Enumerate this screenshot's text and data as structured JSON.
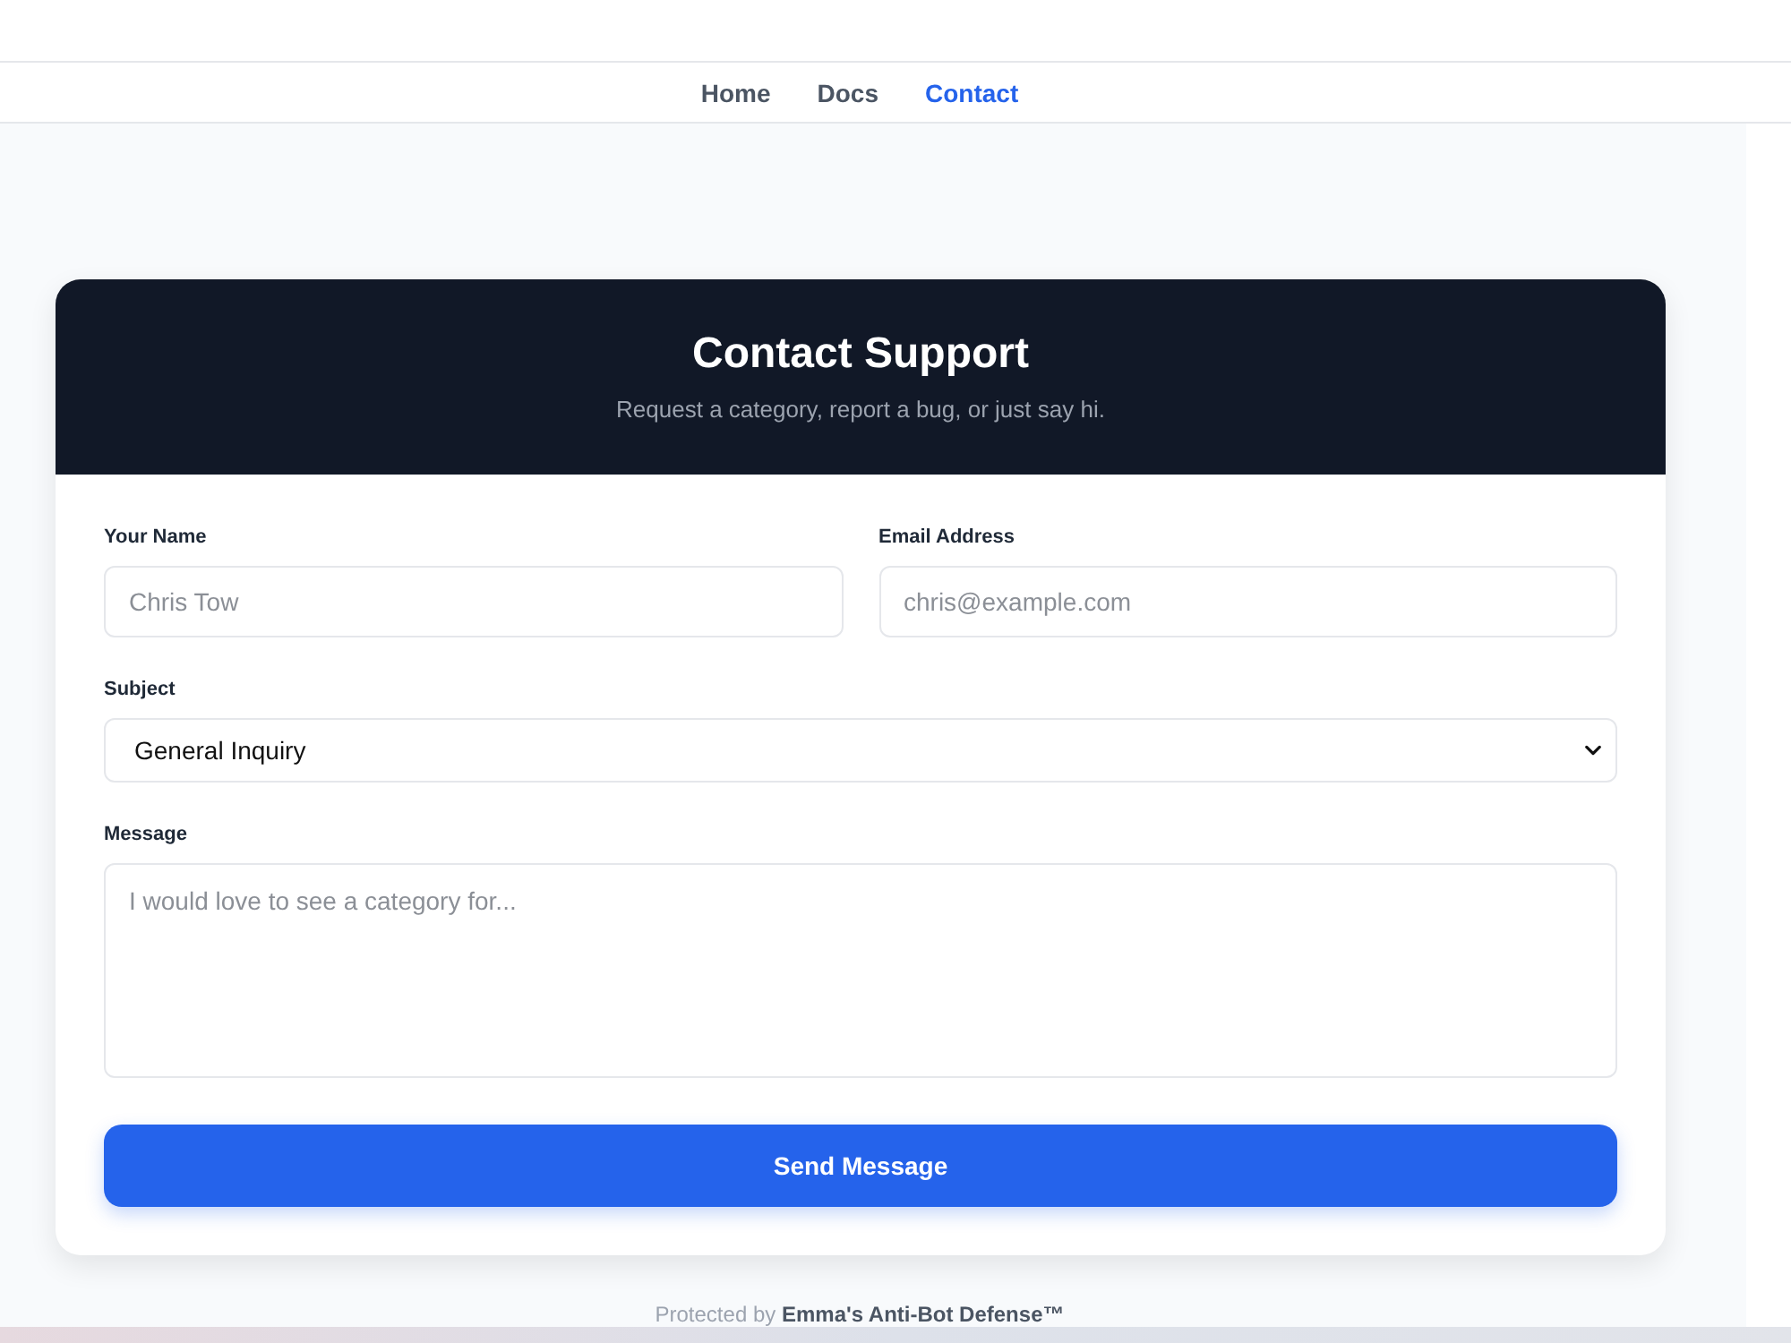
{
  "nav": {
    "links": [
      {
        "label": "Home",
        "selected": false
      },
      {
        "label": "Docs",
        "selected": false
      },
      {
        "label": "Contact",
        "selected": true
      }
    ]
  },
  "card": {
    "title": "Contact Support",
    "subtitle": "Request a category, report a bug, or just say hi."
  },
  "form": {
    "fields": [
      {
        "kind": "text",
        "label": "Your Name",
        "placeholder": "Chris Tow"
      },
      {
        "kind": "text",
        "label": "Email Address",
        "placeholder": "chris@example.com"
      },
      {
        "kind": "select",
        "label": "Subject",
        "value": "General Inquiry"
      },
      {
        "kind": "textarea",
        "label": "Message",
        "placeholder": "I would love to see a category for..."
      }
    ],
    "submit": "Send Message"
  },
  "footer": "Protected by **Emma's Anti-Bot Defense™**"
}
